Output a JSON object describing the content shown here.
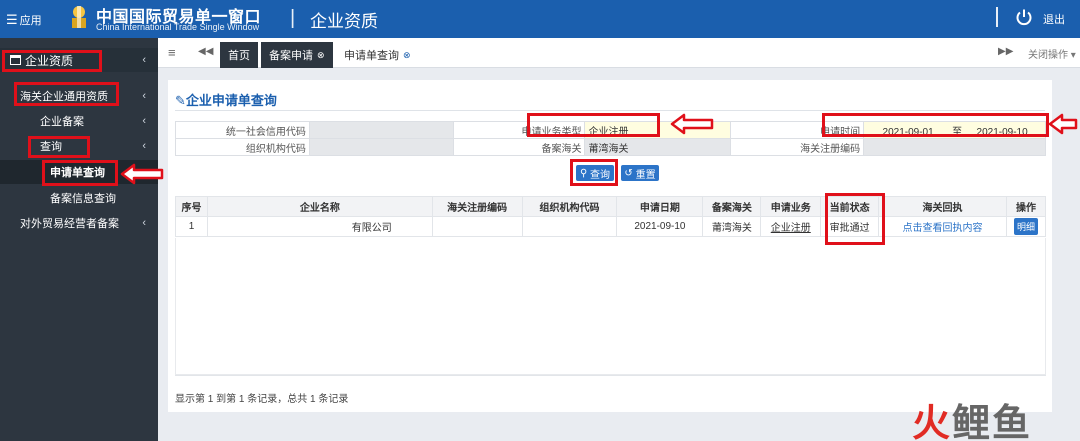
{
  "header": {
    "apps_label": "应用",
    "brand_cn": "中国国际贸易单一窗口",
    "brand_en": "China International Trade Single Window",
    "module_title": "企业资质",
    "logout_label": "退出"
  },
  "sidebar": {
    "top": "企业资质",
    "items": [
      {
        "label": "海关企业通用资质",
        "level": 1
      },
      {
        "label": "企业备案",
        "level": 2
      },
      {
        "label": "查询",
        "level": 2
      },
      {
        "label": "申请单查询",
        "level": 3
      },
      {
        "label": "备案信息查询",
        "level": 3
      },
      {
        "label": "对外贸易经营者备案",
        "level": 1
      }
    ]
  },
  "tabs": {
    "home": "首页",
    "bean": "备案申请",
    "query": "申请单查询",
    "close_ops": "关闭操作"
  },
  "page": {
    "title": "企业申请单查询"
  },
  "form": {
    "uscc_label": "统一社会信用代码",
    "biz_type_label": "申请业务类型",
    "biz_type_value": "企业注册",
    "apply_time_label": "申请时间",
    "date_from": "2021-09-01",
    "date_to_label": "至",
    "date_to": "2021-09-10",
    "org_code_label": "组织机构代码",
    "customs_label": "备案海关",
    "customs_value": "莆湾海关",
    "reg_code_label": "海关注册编码"
  },
  "buttons": {
    "query": "查询",
    "reset": "重置"
  },
  "grid": {
    "headers": [
      "序号",
      "企业名称",
      "海关注册编码",
      "组织机构代码",
      "申请日期",
      "备案海关",
      "申请业务",
      "当前状态",
      "海关回执",
      "操作"
    ],
    "rows": [
      {
        "no": "1",
        "name": "有限公司",
        "reg_code": "",
        "org_code": "",
        "date": "2021-09-10",
        "customs": "莆湾海关",
        "business": "企业注册",
        "status": "审批通过",
        "receipt": "点击查看回执内容",
        "op": "明细"
      }
    ]
  },
  "pager": "显示第 1 到第 1 条记录，总共 1 条记录",
  "watermark": {
    "a": "火",
    "b": "鲤鱼"
  }
}
